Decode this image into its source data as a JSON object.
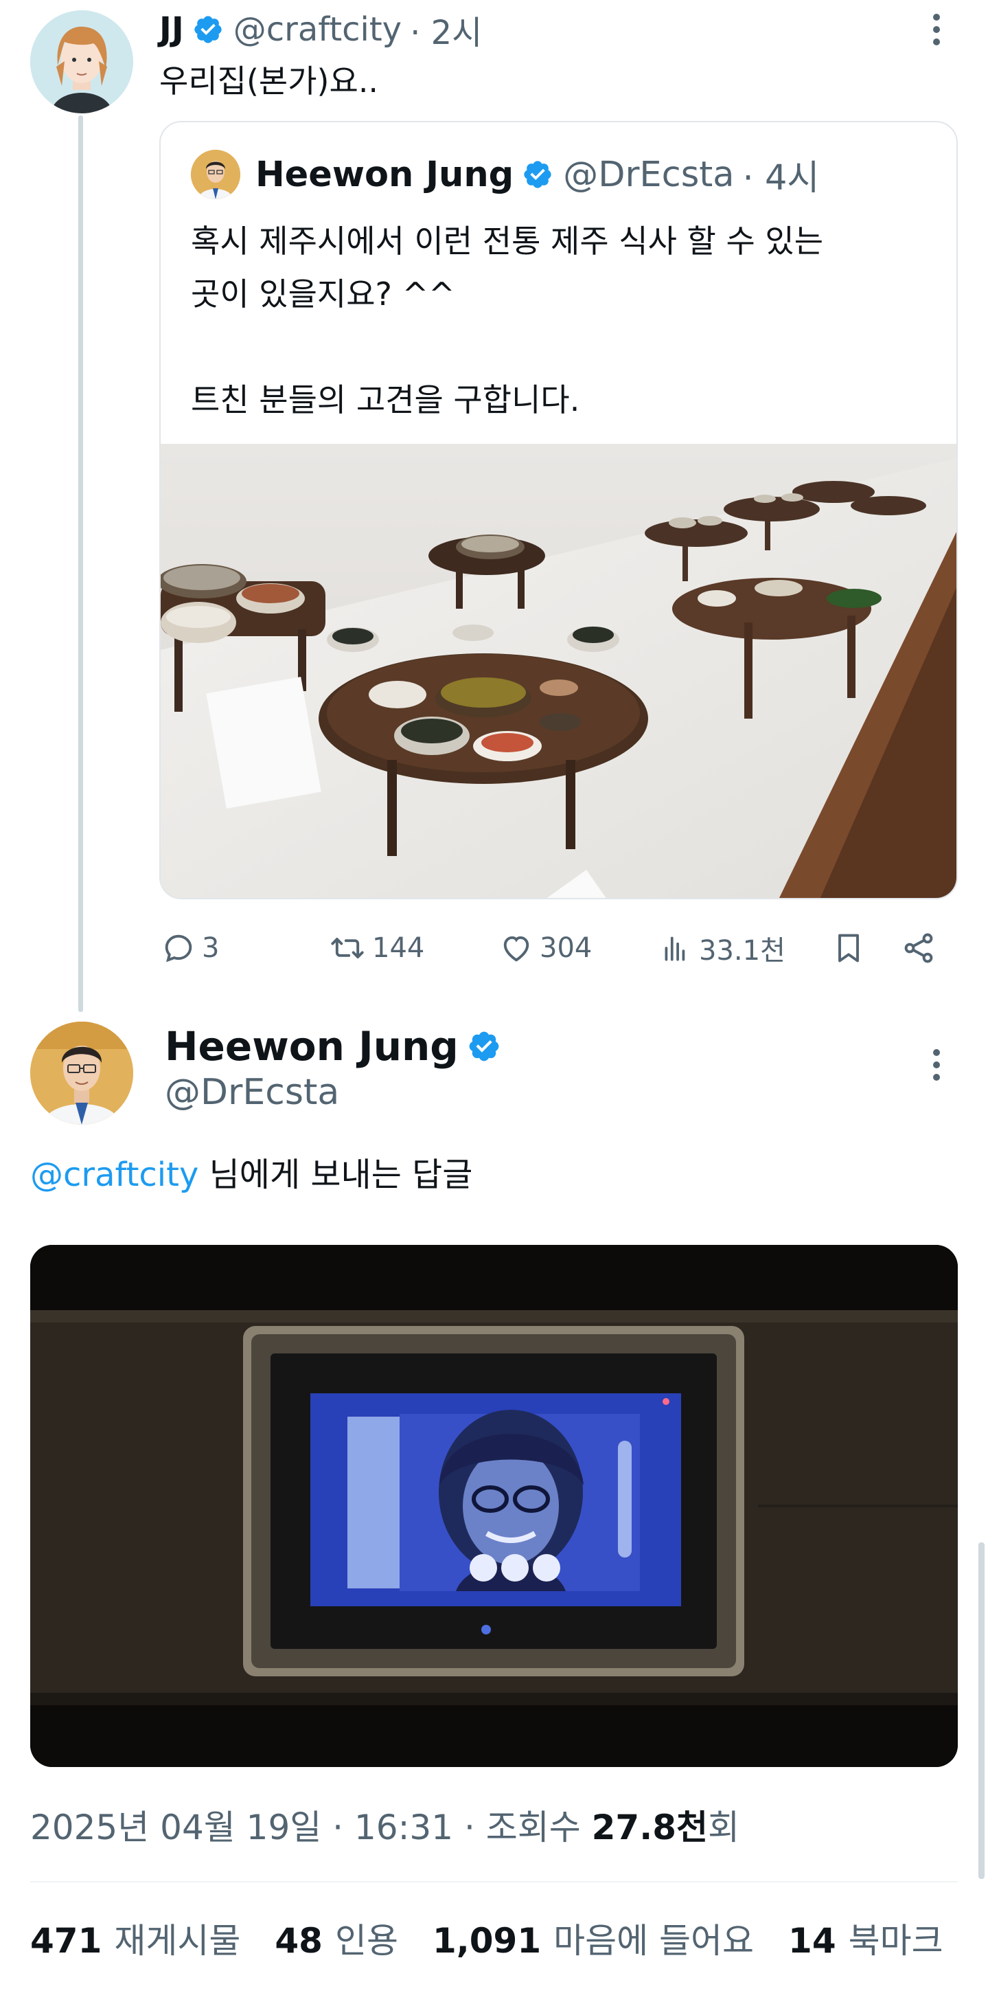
{
  "original_tweet": {
    "name": "JJ",
    "handle": "@craftcity",
    "time": "· 2시",
    "text": "우리집(본가)요.."
  },
  "quoted_tweet": {
    "name": "Heewon Jung",
    "handle": "@DrEcsta",
    "time": "· 4시",
    "lines": [
      "혹시 제주시에서 이런 전통 제주 식사 할 수 있는",
      "곳이 있을지요? ^^",
      "",
      "트친 분들의 고견을 구합니다."
    ],
    "image_alt": "traditional-jeju-meal-display"
  },
  "actions": {
    "replies": "3",
    "retweets": "144",
    "likes": "304",
    "views": "33.1천"
  },
  "reply_tweet": {
    "name": "Heewon Jung",
    "handle": "@DrEcsta",
    "mention": "@craftcity",
    "reply_suffix": " 님에게 보내는 답글"
  },
  "meta": {
    "datetime": "2025년 04월 19일 · 16:31 · 조회수 ",
    "views": "27.8천",
    "views_suffix": "회"
  },
  "stats": {
    "retweets_count": "471",
    "retweets_label": "재게시물",
    "quotes_count": "48",
    "quotes_label": "인용",
    "likes_count": "1,091",
    "likes_label": "마음에 들어요",
    "bookmarks_count": "14",
    "bookmarks_label": "북마크"
  },
  "colors": {
    "verified": "#1d9bf0",
    "link": "#1d9bf0",
    "muted": "#536471"
  }
}
